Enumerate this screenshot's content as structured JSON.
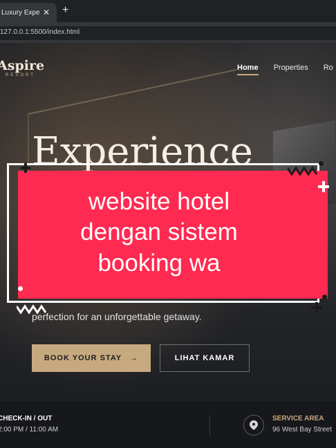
{
  "browser": {
    "tab_title": "Luxury Experienc",
    "tab_close": "✕",
    "new_tab": "+",
    "url": "127.0.0.1:5500/index.html"
  },
  "site": {
    "brand": "Aspire",
    "brand_sub": "RESORT",
    "nav": [
      "Home",
      "Properties",
      "Ro"
    ],
    "headline": "Experience",
    "subtext": "perfection for an unforgettable getaway.",
    "cta_primary": "BOOK YOUR STAY",
    "cta_primary_arrow": "→",
    "cta_secondary": "LIHAT KAMAR",
    "info": {
      "checkin_title": "CHECK-IN / OUT",
      "checkin_value": "2:00 PM / 11:00 AM",
      "service_title": "SERVICE AREA",
      "service_value": "96 West Bay Street"
    }
  },
  "overlay": {
    "lines": [
      "website hotel",
      "dengan sistem",
      "booking wa"
    ],
    "card_color": "#ff2a51"
  },
  "icons": {
    "pin": "map-pin-icon"
  },
  "colors": {
    "accent_gold": "#c6a97f",
    "overlay_red": "#ff2a51"
  }
}
